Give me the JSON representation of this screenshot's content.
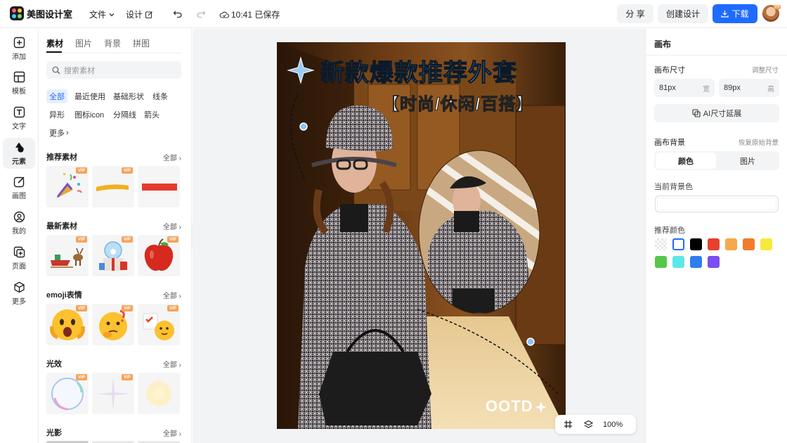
{
  "app": {
    "name": "美图设计室",
    "save_status": "10:41 已保存"
  },
  "topbar": {
    "file_label": "文件",
    "design_label": "设计",
    "share_label": "分 享",
    "create_label": "创建设计",
    "download_label": "下载",
    "avatar_badge": "VIP"
  },
  "leftnav": [
    {
      "label": "添加",
      "icon": "plus-square-icon"
    },
    {
      "label": "模板",
      "icon": "template-icon"
    },
    {
      "label": "文字",
      "icon": "text-icon"
    },
    {
      "label": "元素",
      "icon": "shapes-icon",
      "active": true
    },
    {
      "label": "画图",
      "icon": "draw-icon"
    },
    {
      "label": "我的",
      "icon": "user-icon"
    },
    {
      "label": "页面",
      "icon": "page-add-icon"
    },
    {
      "label": "更多",
      "icon": "cube-icon"
    }
  ],
  "panel": {
    "tabs": [
      "素材",
      "图片",
      "背景",
      "拼图"
    ],
    "search_placeholder": "搜索素材",
    "chips": [
      "全部",
      "最近使用",
      "基础形状",
      "线条",
      "异形",
      "图标icon",
      "分隔线",
      "箭头",
      "更多"
    ],
    "all_label": "全部",
    "vip_label": "VIP",
    "sections": [
      {
        "title": "推荐素材"
      },
      {
        "title": "最新素材"
      },
      {
        "title": "emoji表情"
      },
      {
        "title": "光效"
      },
      {
        "title": "光影"
      }
    ]
  },
  "canvas": {
    "title_line1": "新款爆款推荐外套",
    "title_line2": "【时尚/休闲/百搭】",
    "footer_text": "OOTD",
    "zoom": "100%"
  },
  "rightpanel": {
    "title": "画布",
    "size_label": "画布尺寸",
    "adjust_link": "调整尺寸",
    "width_value": "81px",
    "width_unit": "宽",
    "height_value": "89px",
    "height_unit": "高",
    "ai_extend": "AI尺寸延展",
    "bg_label": "画布背景",
    "restore_link": "恢复原始背景",
    "bg_tabs": [
      "颜色",
      "图片"
    ],
    "current_bg_label": "当前背景色",
    "recommend_label": "推荐颜色",
    "colors": [
      "#ffffff",
      "#000000",
      "#e8402c",
      "#f4a94c",
      "#f07d2c",
      "#f8ea3c",
      "#54c84a",
      "#5ce8e8",
      "#2f7df0",
      "#7c4df0"
    ]
  }
}
